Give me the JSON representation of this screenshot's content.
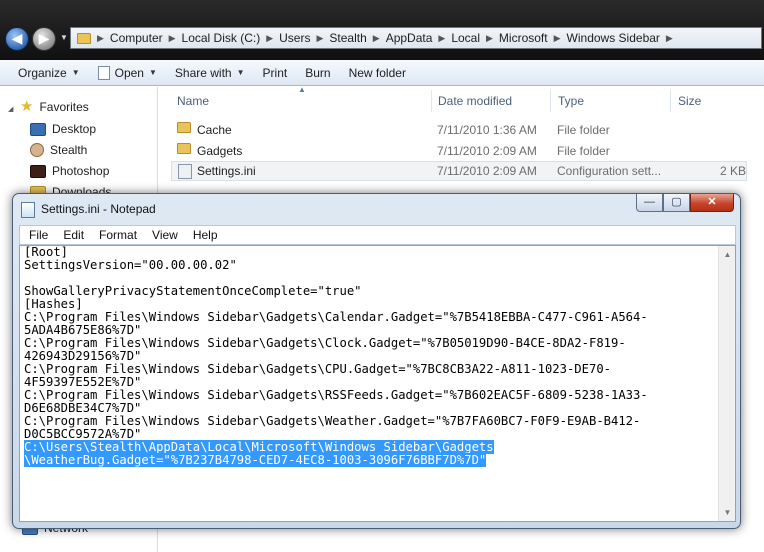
{
  "explorer": {
    "breadcrumb": [
      "Computer",
      "Local Disk (C:)",
      "Users",
      "Stealth",
      "AppData",
      "Local",
      "Microsoft",
      "Windows Sidebar"
    ],
    "toolbar": {
      "organize": "Organize",
      "open": "Open",
      "share_with": "Share with",
      "print": "Print",
      "burn": "Burn",
      "new_folder": "New folder"
    },
    "nav": {
      "favorites": "Favorites",
      "items": [
        "Desktop",
        "Stealth",
        "Photoshop",
        "Downloads"
      ],
      "network": "Network"
    },
    "columns": {
      "name": "Name",
      "date": "Date modified",
      "type": "Type",
      "size": "Size"
    },
    "files": [
      {
        "name": "Cache",
        "date": "7/11/2010 1:36 AM",
        "type": "File folder",
        "size": "",
        "icon": "folder-icon"
      },
      {
        "name": "Gadgets",
        "date": "7/11/2010 2:09 AM",
        "type": "File folder",
        "size": "",
        "icon": "folder-icon"
      },
      {
        "name": "Settings.ini",
        "date": "7/11/2010 2:09 AM",
        "type": "Configuration sett...",
        "size": "2 KB",
        "icon": "ini-file-icon"
      }
    ]
  },
  "notepad": {
    "title": "Settings.ini - Notepad",
    "buttons": {
      "minimize": "—",
      "maximize": "▢",
      "close": "✕"
    },
    "menu": [
      "File",
      "Edit",
      "Format",
      "View",
      "Help"
    ],
    "lines": [
      "[Root]",
      "SettingsVersion=\"00.00.00.02\"",
      "",
      "ShowGalleryPrivacyStatementOnceComplete=\"true\"",
      "[Hashes]",
      "C:\\Program Files\\Windows Sidebar\\Gadgets\\Calendar.Gadget=\"%7B5418EBBA-C477-C961-A564-",
      "5ADA4B675E86%7D\"",
      "C:\\Program Files\\Windows Sidebar\\Gadgets\\Clock.Gadget=\"%7B05019D90-B4CE-8DA2-F819-",
      "426943D29156%7D\"",
      "C:\\Program Files\\Windows Sidebar\\Gadgets\\CPU.Gadget=\"%7BC8CB3A22-A811-1023-DE70-",
      "4F59397E552E%7D\"",
      "C:\\Program Files\\Windows Sidebar\\Gadgets\\RSSFeeds.Gadget=\"%7B602EAC5F-6809-5238-1A33-",
      "D6E68DBE34C7%7D\"",
      "C:\\Program Files\\Windows Sidebar\\Gadgets\\Weather.Gadget=\"%7B7FA60BC7-F0F9-E9AB-B412-",
      "D0C5BCC9572A%7D\"",
      "C:\\Users\\Stealth\\AppData\\Local\\Microsoft\\Windows Sidebar\\Gadgets",
      "\\WeatherBug.Gadget=\"%7B237B4798-CED7-4EC8-1003-3096F76BBF7D%7D\""
    ],
    "selected_lines": [
      15,
      16
    ]
  },
  "colors": {
    "selection": "#3399ff",
    "close_button": "#c7452d",
    "title_bar": "#dfe9f4",
    "address_bar": "#1a1a1a"
  }
}
